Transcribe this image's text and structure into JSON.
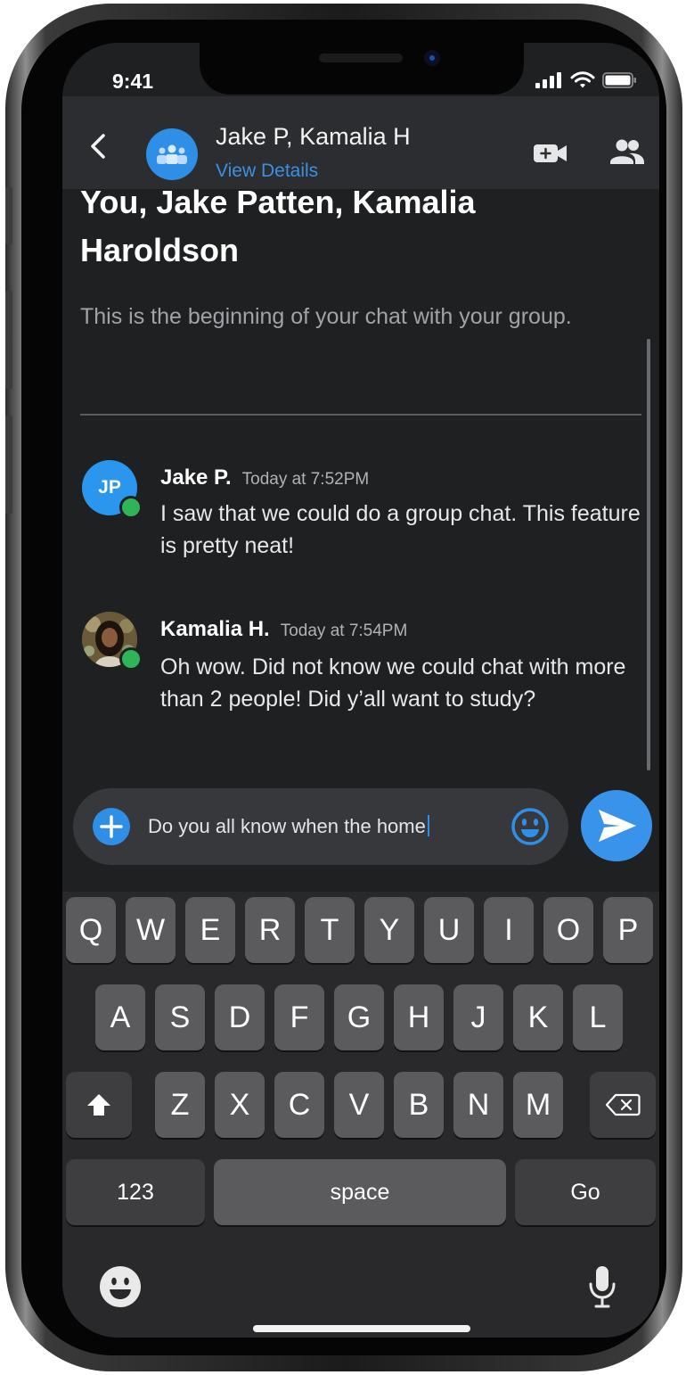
{
  "status": {
    "time": "9:41"
  },
  "header": {
    "title": "Jake P, Kamalia H",
    "subtitle": "View Details"
  },
  "intro": {
    "title": "You, Jake Patten, Kamalia Haroldson",
    "text": "This is the beginning of your chat with your group."
  },
  "messages": [
    {
      "initials": "JP",
      "name": "Jake P.",
      "time": "Today at 7:52PM",
      "text": "I saw that we could do a group chat. This feature is pretty neat!"
    },
    {
      "name": "Kamalia H.",
      "time": "Today at 7:54PM",
      "text": "Oh wow. Did not know we could chat with more than 2 people! Did y’all want to study?"
    }
  ],
  "composer": {
    "text": "Do you all know when the home"
  },
  "keyboard": {
    "row1": [
      "Q",
      "W",
      "E",
      "R",
      "T",
      "Y",
      "U",
      "I",
      "O",
      "P"
    ],
    "row2": [
      "A",
      "S",
      "D",
      "F",
      "G",
      "H",
      "J",
      "K",
      "L"
    ],
    "row3": [
      "Z",
      "X",
      "C",
      "V",
      "B",
      "N",
      "M"
    ],
    "numbers": "123",
    "space": "space",
    "go": "Go"
  },
  "colors": {
    "accent": "#2f8fe6",
    "online": "#30b45a",
    "background": "#1f2022",
    "header": "#2c2d30"
  }
}
